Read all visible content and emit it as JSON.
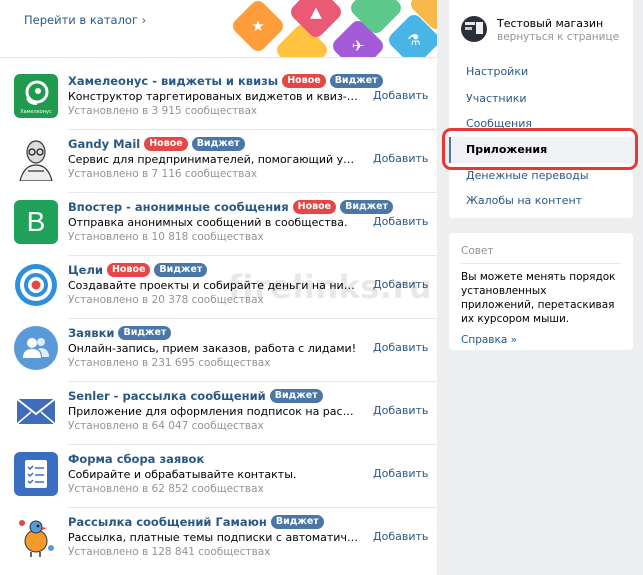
{
  "banner": {
    "catalog_link": "Перейти в каталог ›"
  },
  "apps": [
    {
      "title": "Хамелеонус - виджеты и квизы",
      "badges": [
        "Новое",
        "Виджет"
      ],
      "description": "Конструктор таргетированых виджетов и квиз-тестов дл...",
      "installs": "Установлено в 3 915 сообществах",
      "add_label": "Добавить",
      "icon": "chameleon-icon",
      "icon_text": "Хамелеонус"
    },
    {
      "title": "Gandy Mail",
      "badges": [
        "Новое",
        "Виджет"
      ],
      "description": "Сервис для предпринимателей, помогающий увеличить ...",
      "installs": "Установлено в 7 116 сообществах",
      "add_label": "Добавить",
      "icon": "gandhi-portrait-icon"
    },
    {
      "title": "Впостер - анонимные сообщения",
      "badges": [
        "Новое",
        "Виджет"
      ],
      "description": "Отправка анонимных сообщений в сообщества.",
      "installs": "Установлено в 10 818 сообществах",
      "add_label": "Добавить",
      "icon": "letter-b-icon",
      "icon_text": "B"
    },
    {
      "title": "Цели",
      "badges": [
        "Новое",
        "Виджет"
      ],
      "description": "Создавайте проекты и собирайте деньги на них в сообщ...",
      "installs": "Установлено в 20 378 сообществах",
      "add_label": "Добавить",
      "icon": "target-icon"
    },
    {
      "title": "Заявки",
      "badges": [
        "Виджет"
      ],
      "description": "Онлайн-запись, прием заказов, работа с лидами!",
      "installs": "Установлено в 231 695 сообществах",
      "add_label": "Добавить",
      "icon": "people-icon"
    },
    {
      "title": "Senler - рассылка сообщений",
      "badges": [
        "Виджет"
      ],
      "description": "Приложение для оформления подписок на рассылки.",
      "installs": "Установлено в 64 047 сообществах",
      "add_label": "Добавить",
      "icon": "envelope-icon"
    },
    {
      "title": "Форма сбора заявок",
      "badges": [],
      "description": "Собирайте и обрабатывайте контакты.",
      "installs": "Установлено в 62 852 сообществах",
      "add_label": "Добавить",
      "icon": "checklist-icon"
    },
    {
      "title": "Рассылка сообщений Гамаюн",
      "badges": [
        "Виджет"
      ],
      "description": "Рассылка, платные темы подписки с автоматическим пр...",
      "installs": "Установлено в 128 841 сообществах",
      "add_label": "Добавить",
      "icon": "bird-icon"
    }
  ],
  "sidebar": {
    "group_name": "Тестовый магазин",
    "back_link": "вернуться к странице",
    "menu": [
      {
        "label": "Настройки",
        "active": false
      },
      {
        "label": "Участники",
        "active": false
      },
      {
        "label": "Сообщения",
        "active": false
      },
      {
        "label": "Приложения",
        "active": true
      },
      {
        "label": "Денежные переводы",
        "active": false
      },
      {
        "label": "Жалобы на контент",
        "active": false
      }
    ]
  },
  "tip": {
    "title": "Совет",
    "text": "Вы можете менять порядок установленных приложений, перетаскивая их курсором мыши.",
    "link": "Справка »"
  },
  "watermark": "firelinks.ru",
  "colors": {
    "link": "#2a5885",
    "badge_new": "#e64646",
    "badge_widget": "#4a76a8",
    "highlight": "#e53935"
  }
}
